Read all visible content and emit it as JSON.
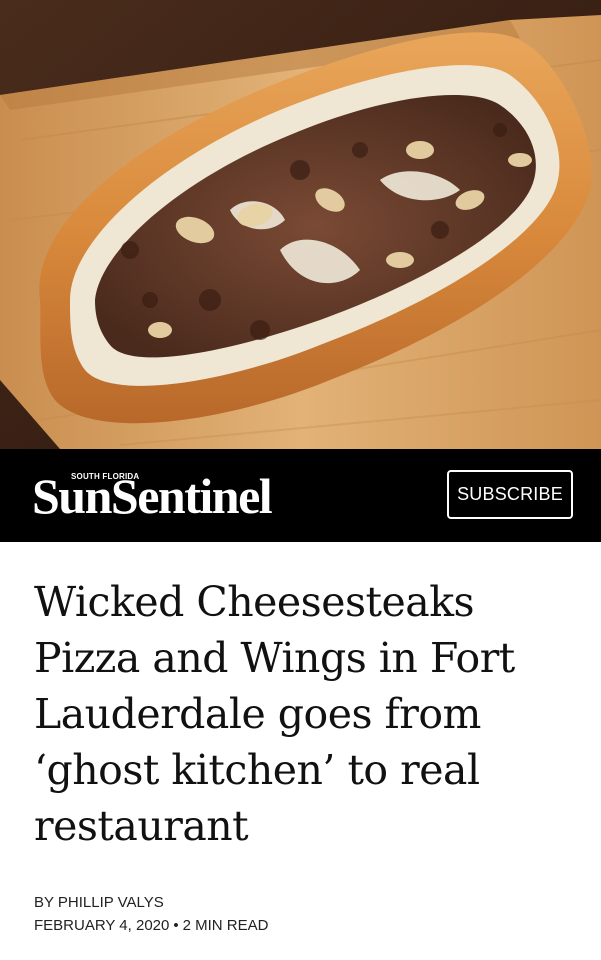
{
  "hero": {
    "image_alt": "cheesesteak-sandwich-on-cutting-board"
  },
  "masthead": {
    "kicker": "SOUTH FLORIDA",
    "logo": "SunSentinel",
    "subscribe_label": "SUBSCRIBE"
  },
  "article": {
    "headline": "Wicked Cheesesteaks Pizza and Wings in Fort Lauderdale goes from ‘ghost kitchen’ to real restaurant",
    "byline": "BY PHILLIP VALYS",
    "date": "FEBRUARY 4, 2020",
    "separator": "•",
    "read_time": "2 MIN READ"
  },
  "colors": {
    "masthead_bg": "#000000",
    "text": "#111111",
    "board": "#d8a462",
    "table": "#3a2418"
  }
}
